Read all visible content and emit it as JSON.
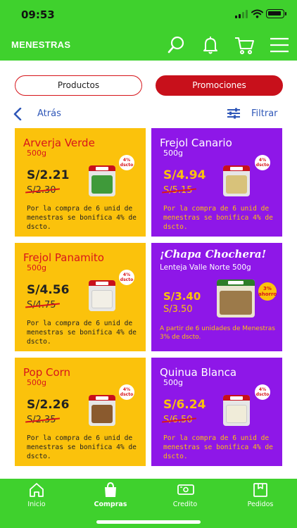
{
  "status": {
    "time": "09:53"
  },
  "header": {
    "title": "MENESTRAS"
  },
  "segments": {
    "products_label": "Productos",
    "promotions_label": "Promociones"
  },
  "nav": {
    "back_label": "Atrás",
    "filter_label": "Filtrar"
  },
  "cards": [
    {
      "name": "Arverja Verde",
      "weight": "500g",
      "price": "S/2.21",
      "old_price": "S/2.30",
      "badge": "4% dscto",
      "desc": "Por la compra de 6 unid de menestras se bonifica 4% de dscto."
    },
    {
      "name": "Frejol Canario",
      "weight": "500g",
      "price": "S/4.94",
      "old_price": "S/5.15",
      "badge": "4% dscto",
      "desc": "Por la compra de 6 unid de menestras se bonifica 4% de dscto."
    },
    {
      "name": "Frejol Panamito",
      "weight": "500g",
      "price": "S/4.56",
      "old_price": "S/4.75",
      "badge": "4% dscto",
      "desc": "Por la compra de 6 unid de menestras se bonifica 4% de dscto."
    },
    {
      "name": "¡Chapa Chochera!",
      "weight": "Lenteja Valle Norte 500g",
      "price": "S/3.40",
      "old_price": "S/3.50",
      "badge": "3% ahorro",
      "desc": "A partir de 6 unidades de Menestras 3% de dscto."
    },
    {
      "name": "Pop Corn",
      "weight": "500g",
      "price": "S/2.26",
      "old_price": "S/2.35",
      "badge": "4% dscto",
      "desc": "Por la compra de 6 unid de menestras se bonifica 4% de dscto."
    },
    {
      "name": "Quinua Blanca",
      "weight": "500g",
      "price": "S/6.24",
      "old_price": "S/6.50",
      "badge": "4% dscto",
      "desc": "Por la compra de 6 unid de menestras se bonifica 4% de dscto."
    }
  ],
  "tabbar": {
    "home": "Inicio",
    "shop": "Compras",
    "credit": "Credito",
    "orders": "Pedidos"
  },
  "colors": {
    "green": "#3fd12d",
    "yellow": "#fbc20c",
    "purple": "#8e17e8",
    "red": "#d8151b",
    "link": "#2f57b8"
  },
  "icons": [
    "search-icon",
    "bell-icon",
    "cart-icon",
    "menu-icon",
    "back-chevron-icon",
    "filter-icon",
    "home-icon",
    "shopping-bag-icon",
    "cash-icon",
    "box-icon"
  ]
}
